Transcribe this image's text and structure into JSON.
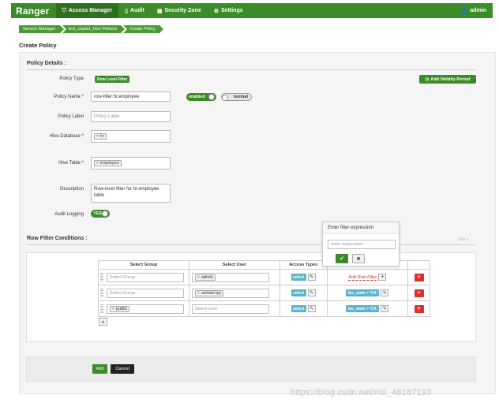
{
  "nav": {
    "brand": "Ranger",
    "items": [
      {
        "icon": "shield-icon",
        "glyph": "⛉",
        "label": "Access Manager",
        "active": true
      },
      {
        "icon": "file-icon",
        "glyph": "🗋",
        "label": "Audit",
        "active": false
      },
      {
        "icon": "lock-box-icon",
        "glyph": "▣",
        "label": "Security Zone",
        "active": false
      },
      {
        "icon": "gear-icon",
        "glyph": "⚙",
        "label": "Settings",
        "active": false
      }
    ],
    "user_icon": "users-icon",
    "user": "admin"
  },
  "breadcrumb": [
    "Service Manager",
    "test_cluster_hive Policies",
    "Create Policy"
  ],
  "page_title": "Create Policy",
  "policy_details": {
    "title": "Policy Details :",
    "policy_type_label": "Policy Type",
    "policy_type": "Row Level Filter",
    "add_validity": "Add Validity Period",
    "policy_name_label": "Policy Name *",
    "policy_name": "row-filter:hr.employee",
    "enabled_label": "enabled",
    "normal_label": "normal",
    "policy_label_label": "Policy Label",
    "policy_label_placeholder": "Policy Label",
    "hive_db_label": "Hive Database *",
    "hive_db_chip": "hr",
    "hive_table_label": "Hive Table *",
    "hive_table_chip": "employee",
    "description_label": "Description",
    "description": "Row-level filter for hr.employee table",
    "audit_label": "Audit Logging",
    "audit_value": "YES"
  },
  "row_filter": {
    "title": "Row Filter Conditions :",
    "hide": "hide ▾",
    "columns": [
      "Select Group",
      "Select User",
      "Access Types",
      "",
      ""
    ],
    "group_placeholder": "Select Group",
    "user_placeholder": "Select User",
    "rows": [
      {
        "group": "",
        "user": "admin",
        "access": "select",
        "filter": "Add Row Filter"
      },
      {
        "group": "",
        "user": "ambari-qa",
        "access": "select",
        "filter": "loc_state = 'CA'"
      },
      {
        "group": "public",
        "user": "",
        "access": "select",
        "filter": "loc_state = 'CA'"
      }
    ]
  },
  "popover": {
    "title": "Enter filter expression",
    "placeholder": "enter expression"
  },
  "footer": {
    "add": "Add",
    "cancel": "Cancel"
  },
  "watermark": "https://blog.csdn.net/m0_48187193"
}
